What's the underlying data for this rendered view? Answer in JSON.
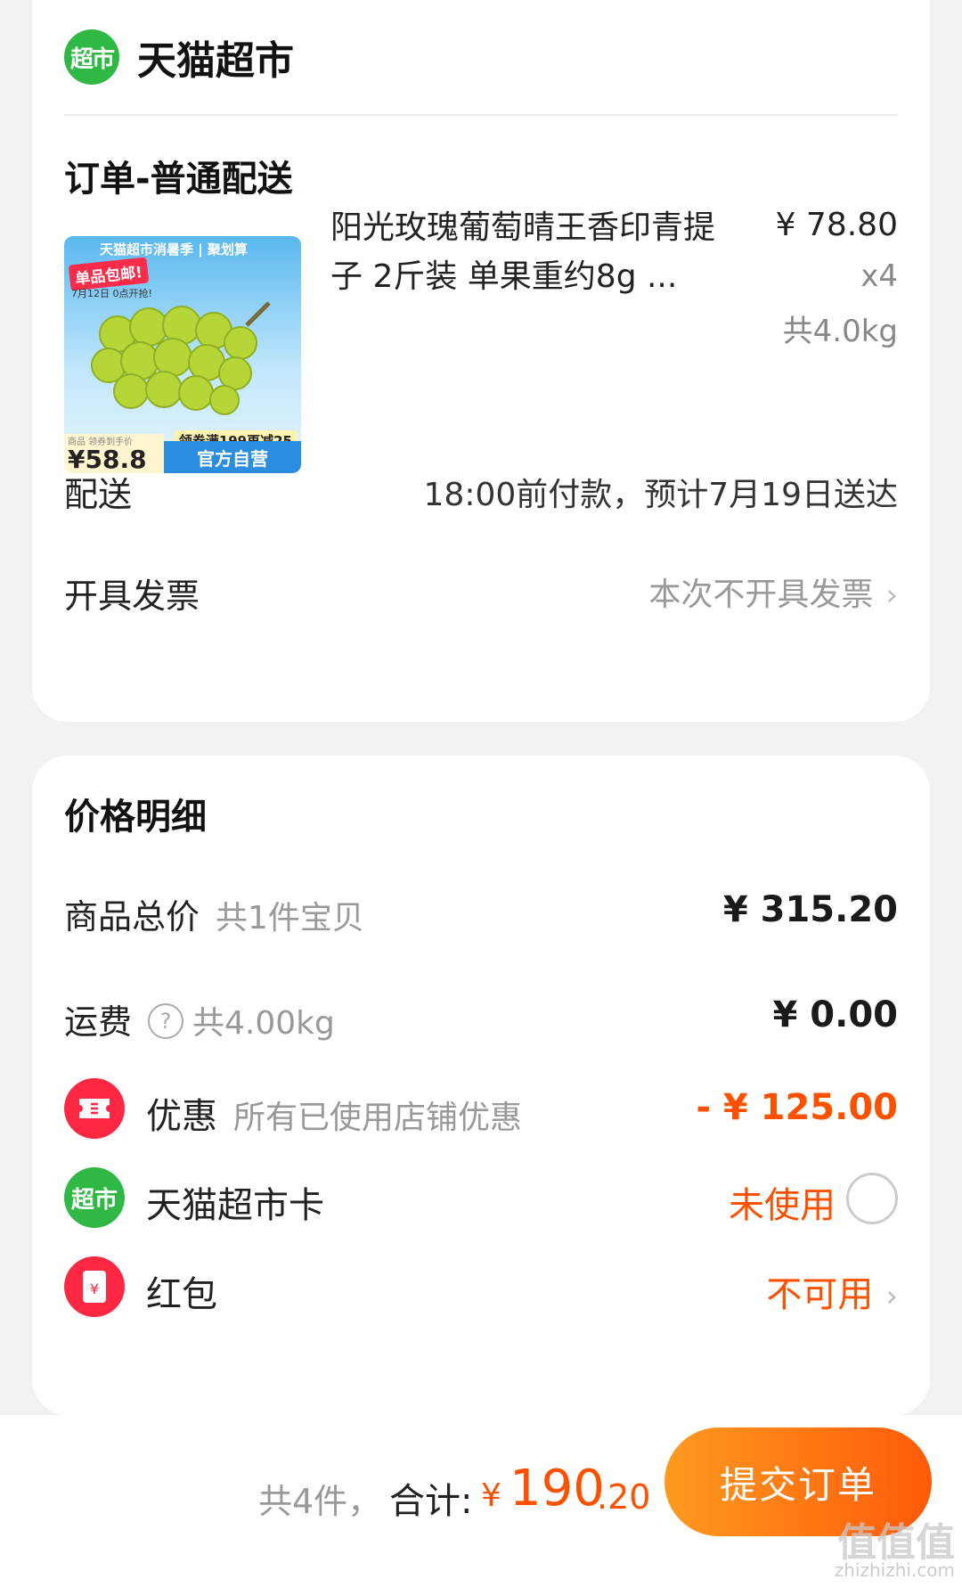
{
  "shop": {
    "logo_text": "超市",
    "name": "天猫超市"
  },
  "order": {
    "section_title": "订单-普通配送",
    "product": {
      "thumb_banner": "天猫超市消暑季 | 聚划算",
      "thumb_tag": "单品包邮!",
      "thumb_date": "7月12日 0点开抢!",
      "thumb_coupon": "领券满199再减25",
      "thumb_price_caption": "商品 领券到手价",
      "thumb_price": "¥58.8",
      "thumb_official": "官方自营",
      "title": "阳光玫瑰葡萄晴王香印青提子 2斤装 单果重约8g ...",
      "price": "¥ 78.80",
      "quantity": "x4",
      "weight": "共4.0kg"
    },
    "delivery": {
      "label": "配送",
      "value": "18:00前付款，预计7月19日送达"
    },
    "invoice": {
      "label": "开具发票",
      "value": "本次不开具发票"
    }
  },
  "price_details": {
    "title": "价格明细",
    "goods_total": {
      "label": "商品总价",
      "sub": "共1件宝贝",
      "amount": "¥ 315.20"
    },
    "shipping": {
      "label": "运费",
      "help": "?",
      "sub": "共4.00kg",
      "amount": "¥ 0.00"
    },
    "discount": {
      "label": "优惠",
      "sub": "所有已使用店铺优惠",
      "amount": "- ¥ 125.00"
    },
    "tmall_card": {
      "icon_text": "超市",
      "label": "天猫超市卡",
      "status": "未使用"
    },
    "red_packet": {
      "icon_text": "¥",
      "label": "红包",
      "status": "不可用"
    }
  },
  "bottom_bar": {
    "count": "共4件，",
    "total_label": "合计:",
    "currency": "¥",
    "total_int": "190",
    "total_dec": ".20",
    "submit_label": "提交订单"
  },
  "watermark": {
    "text": "值值值",
    "url": "zhizhizhi.com"
  },
  "colors": {
    "accent": "#ff5000",
    "brand_green": "#2fb944",
    "red": "#ff2742",
    "background": "#f2f2f2"
  }
}
